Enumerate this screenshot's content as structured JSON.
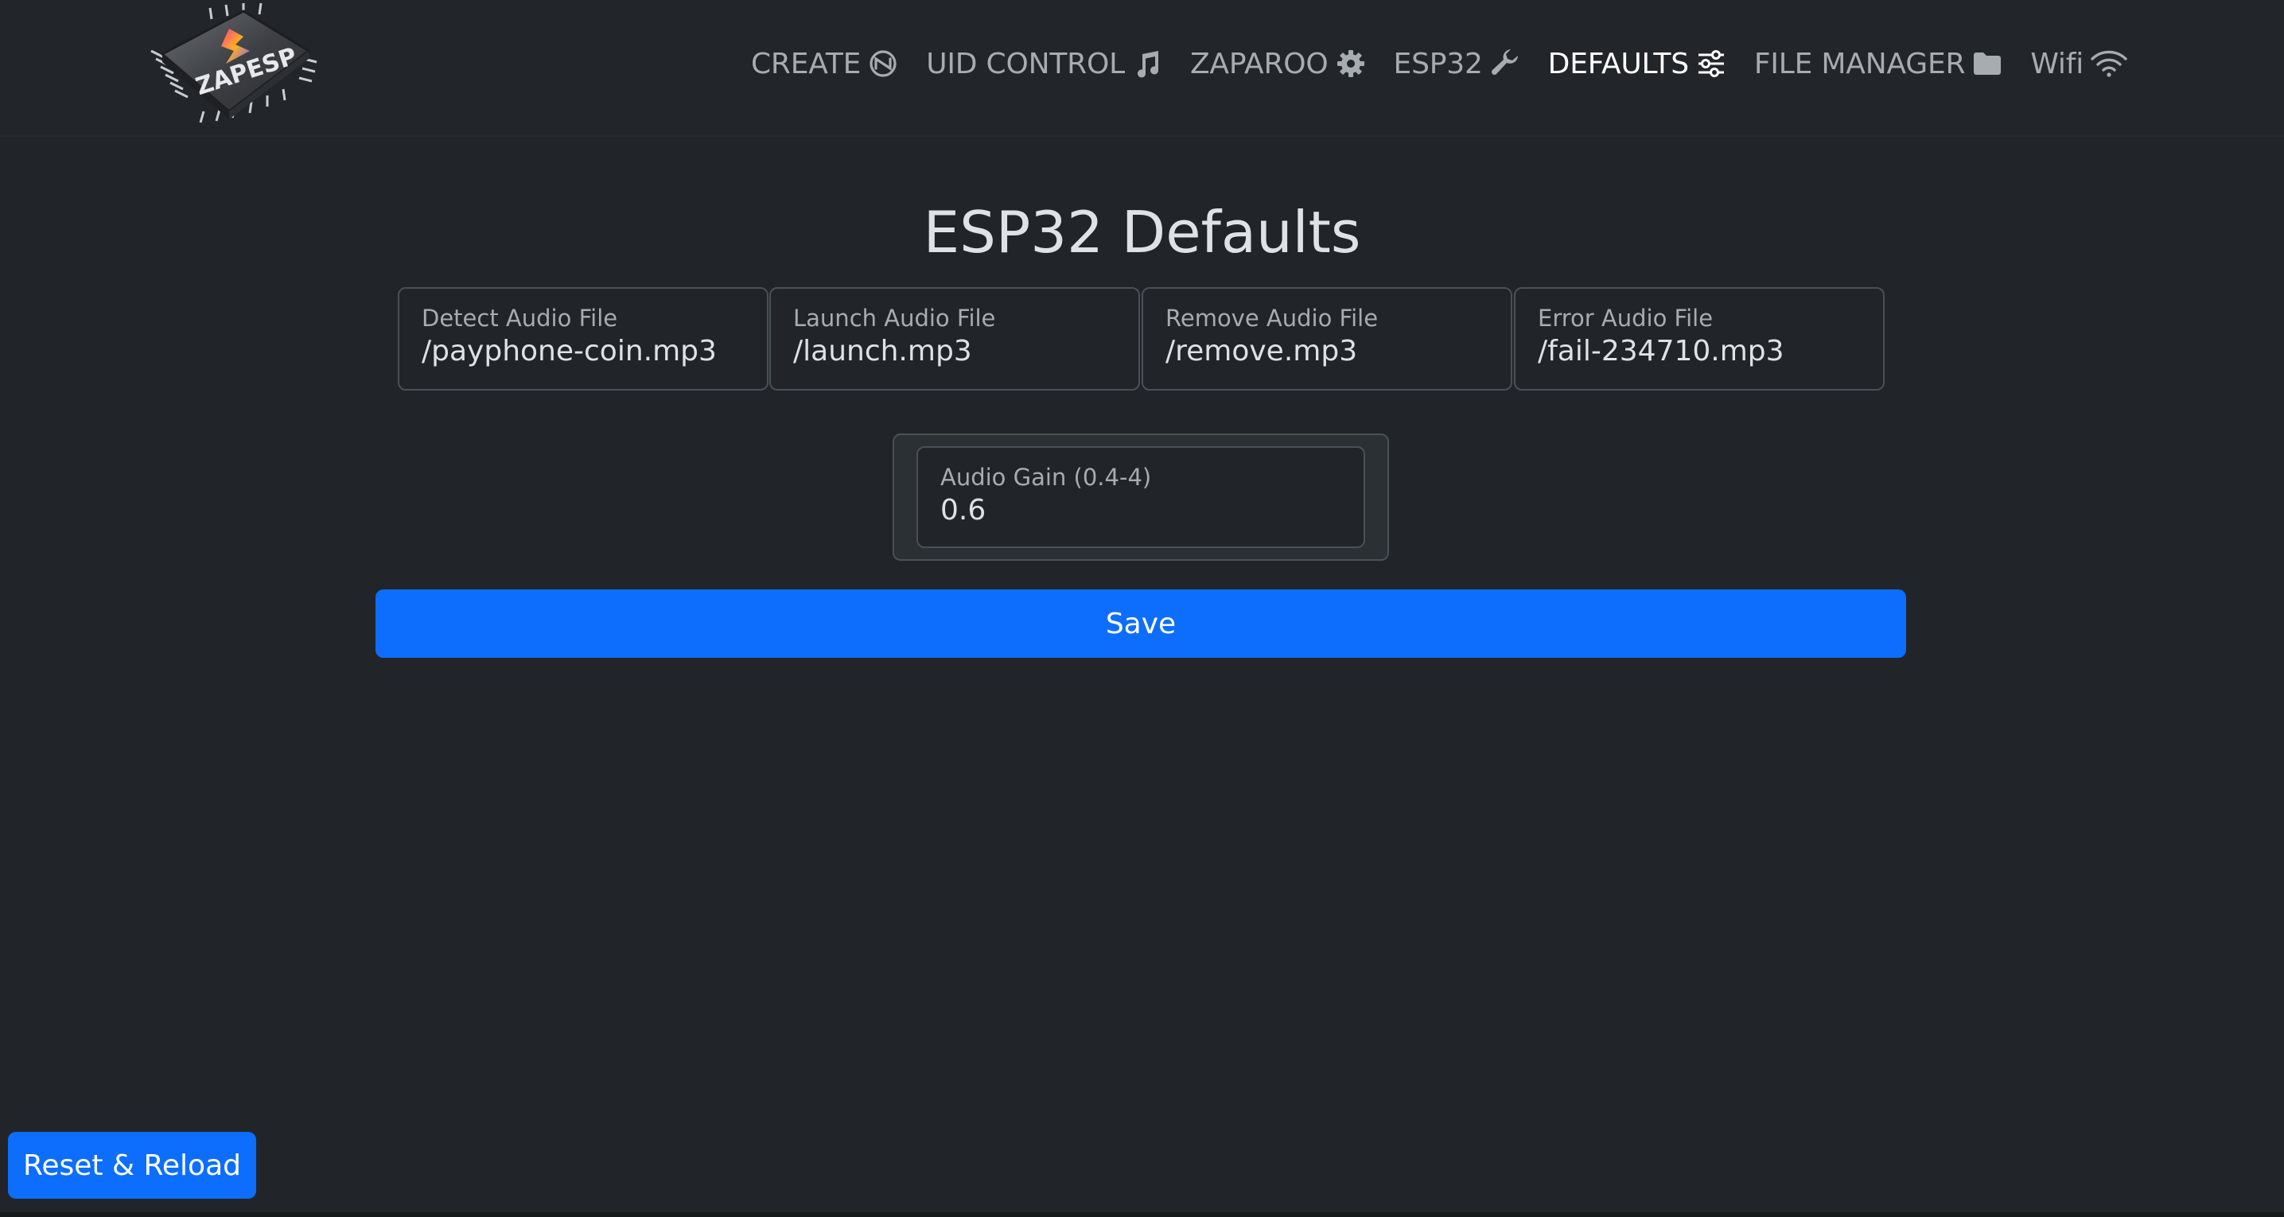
{
  "logo": {
    "text": "ZAPESP"
  },
  "nav": {
    "items": [
      {
        "label": "CREATE",
        "icon": "nfc-icon",
        "active": false
      },
      {
        "label": "UID CONTROL",
        "icon": "music-icon",
        "active": false
      },
      {
        "label": "ZAPAROO",
        "icon": "gear-icon",
        "active": false
      },
      {
        "label": "ESP32",
        "icon": "wrench-icon",
        "active": false
      },
      {
        "label": "DEFAULTS",
        "icon": "sliders-icon",
        "active": true
      },
      {
        "label": "FILE MANAGER",
        "icon": "folder-icon",
        "active": false
      },
      {
        "label": "Wifi",
        "icon": "wifi-icon",
        "active": false
      }
    ]
  },
  "page": {
    "title": "ESP32 Defaults"
  },
  "fields": {
    "detect": {
      "label": "Detect Audio File",
      "value": "/payphone-coin.mp3"
    },
    "launch": {
      "label": "Launch Audio File",
      "value": "/launch.mp3"
    },
    "remove": {
      "label": "Remove Audio File",
      "value": "/remove.mp3"
    },
    "error": {
      "label": "Error Audio File",
      "value": "/fail-234710.mp3"
    },
    "gain": {
      "label": "Audio Gain (0.4-4)",
      "value": "0.6"
    }
  },
  "actions": {
    "save_label": "Save",
    "reset_label": "Reset & Reload"
  },
  "colors": {
    "background": "#212529",
    "accent": "#0d6efd",
    "border": "#495057"
  }
}
